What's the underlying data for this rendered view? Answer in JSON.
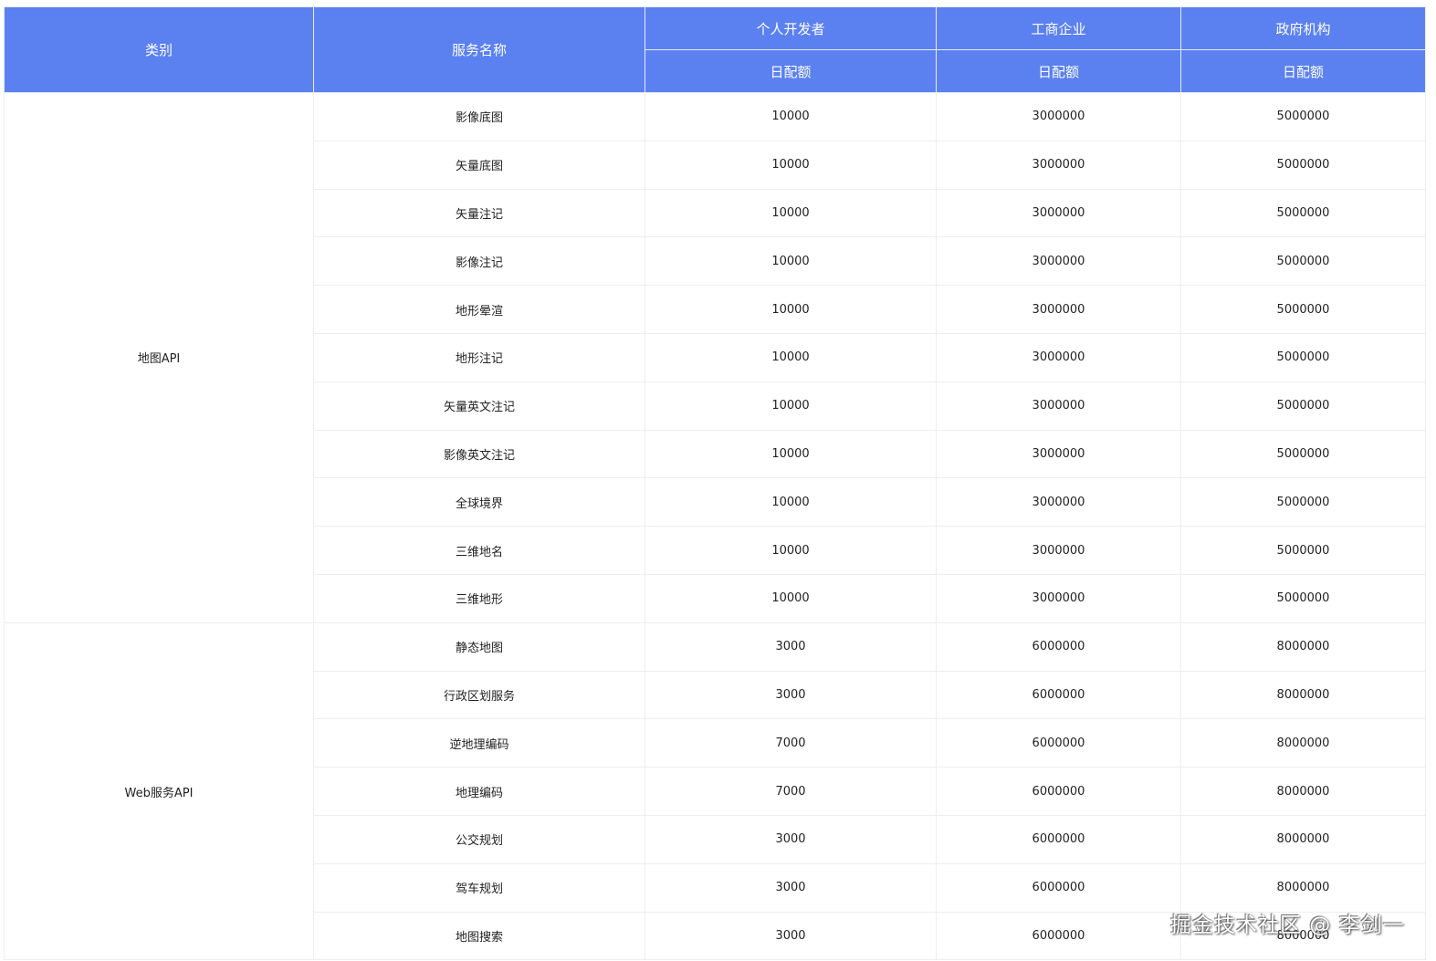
{
  "header": {
    "category": "类别",
    "service": "服务名称",
    "groups": [
      "个人开发者",
      "工商企业",
      "政府机构"
    ],
    "sub": "日配额"
  },
  "sections": [
    {
      "category": "地图API",
      "rows": [
        [
          "影像底图",
          "10000",
          "3000000",
          "5000000"
        ],
        [
          "矢量底图",
          "10000",
          "3000000",
          "5000000"
        ],
        [
          "矢量注记",
          "10000",
          "3000000",
          "5000000"
        ],
        [
          "影像注记",
          "10000",
          "3000000",
          "5000000"
        ],
        [
          "地形晕渲",
          "10000",
          "3000000",
          "5000000"
        ],
        [
          "地形注记",
          "10000",
          "3000000",
          "5000000"
        ],
        [
          "矢量英文注记",
          "10000",
          "3000000",
          "5000000"
        ],
        [
          "影像英文注记",
          "10000",
          "3000000",
          "5000000"
        ],
        [
          "全球境界",
          "10000",
          "3000000",
          "5000000"
        ],
        [
          "三维地名",
          "10000",
          "3000000",
          "5000000"
        ],
        [
          "三维地形",
          "10000",
          "3000000",
          "5000000"
        ]
      ]
    },
    {
      "category": "Web服务API",
      "rows": [
        [
          "静态地图",
          "3000",
          "6000000",
          "8000000"
        ],
        [
          "行政区划服务",
          "3000",
          "6000000",
          "8000000"
        ],
        [
          "逆地理编码",
          "7000",
          "6000000",
          "8000000"
        ],
        [
          "地理编码",
          "7000",
          "6000000",
          "8000000"
        ],
        [
          "公交规划",
          "3000",
          "6000000",
          "8000000"
        ],
        [
          "驾车规划",
          "3000",
          "6000000",
          "8000000"
        ],
        [
          "地图搜索",
          "3000",
          "6000000",
          "8000000"
        ]
      ]
    }
  ],
  "watermark": "掘金技术社区 @ 李剑一"
}
